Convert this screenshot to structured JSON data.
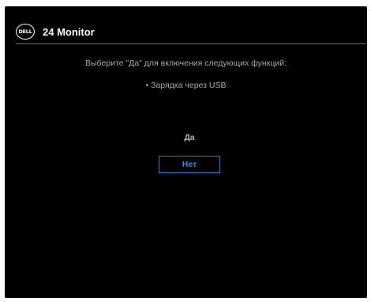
{
  "header": {
    "logo_text": "DELL",
    "title": "24 Monitor"
  },
  "dialog": {
    "prompt": "Выберите \"Да\" для включения следующих функций:",
    "features": [
      "• Зарядка через USB"
    ]
  },
  "options": {
    "yes_label": "Да",
    "no_label": "Нет",
    "selected": "Нет"
  },
  "colors": {
    "background": "#000000",
    "text": "#a7a7a7",
    "accent": "#1f7fd8"
  }
}
